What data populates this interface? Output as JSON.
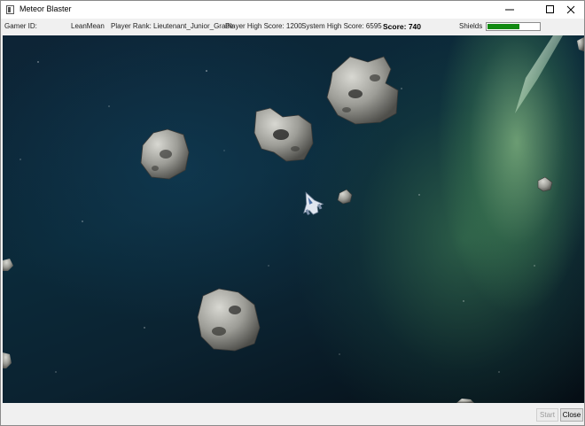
{
  "window": {
    "title": "Meteor Blaster"
  },
  "hud": {
    "gamer_id_label": "Gamer ID:",
    "gamer_id": "LeanMean",
    "rank": "Player Rank: Lieutenant_Junior_Grade",
    "player_high_score": "Player High Score: 1200",
    "system_high_score": "System High Score: 6595",
    "score": "Score: 740",
    "shields_label": "Shields",
    "shields_level": 0.62
  },
  "buttons": {
    "start": "Start",
    "close": "Close"
  },
  "colors": {
    "shield_fill": "#128a12",
    "nebula_green": "#7fd38a",
    "space": "#0b2230"
  },
  "icons": [
    "minimize-icon",
    "maximize-icon",
    "close-icon",
    "app-icon"
  ]
}
